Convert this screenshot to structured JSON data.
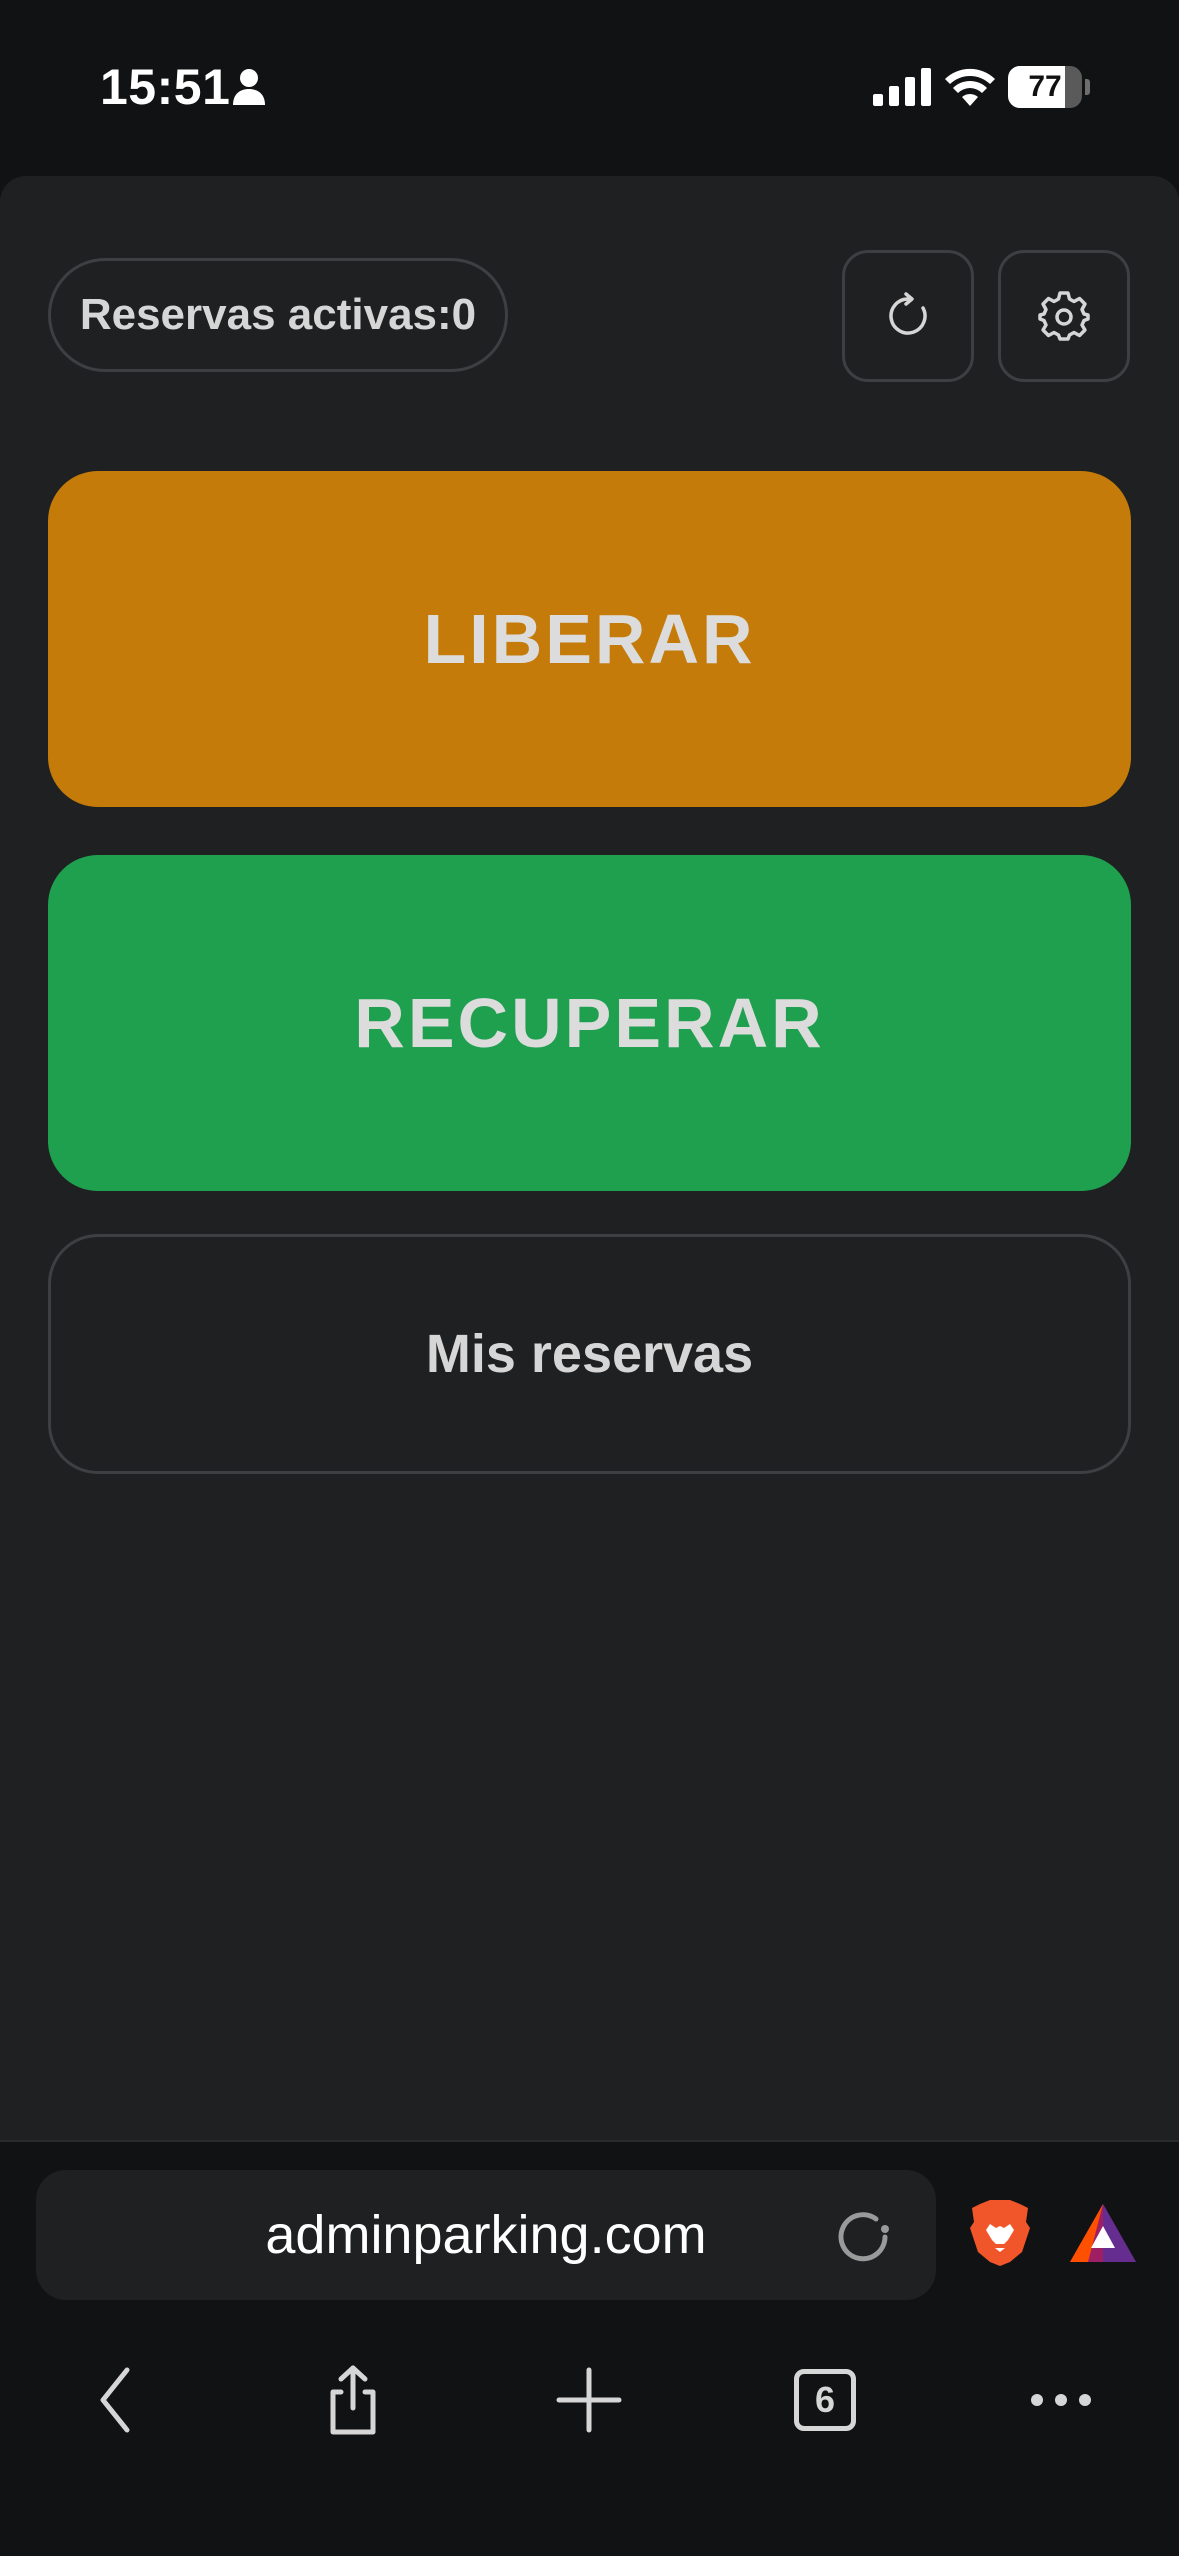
{
  "status_bar": {
    "time": "15:51",
    "battery_level": "77",
    "icons": [
      "person-icon",
      "cellular-signal-icon",
      "wifi-icon",
      "battery-icon"
    ]
  },
  "app": {
    "active_reservations_label": "Reservas activas:0",
    "refresh_icon": "refresh-icon",
    "settings_icon": "gear-icon",
    "release_button": "LIBERAR",
    "recover_button": "RECUPERAR",
    "my_reservations_button": "Mis reservas",
    "colors": {
      "background": "#1f2022",
      "release": "#c47b0a",
      "recover": "#1fa04f",
      "border": "#3d3f42"
    }
  },
  "browser": {
    "url": "adminparking.com",
    "tab_count": "6",
    "icons": [
      "reload-icon",
      "brave-lion-icon",
      "bat-rewards-icon",
      "back-icon",
      "share-icon",
      "new-tab-icon",
      "tabs-icon",
      "more-icon"
    ]
  }
}
